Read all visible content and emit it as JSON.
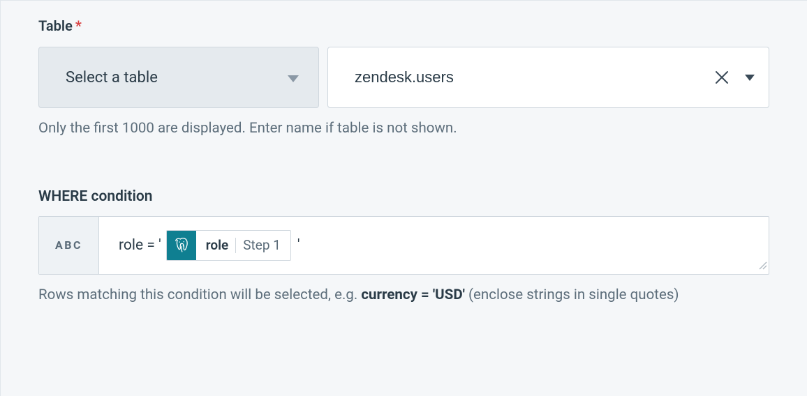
{
  "table": {
    "label": "Table",
    "required_mark": "*",
    "select_placeholder": "Select a table",
    "value": "zendesk.users",
    "helper": "Only the first 1000 are displayed. Enter name if table is not shown."
  },
  "where": {
    "label": "WHERE condition",
    "abc_label": "ABC",
    "expr_prefix": "role = '",
    "token_name": "role",
    "token_step": "Step 1",
    "expr_suffix": "'",
    "helper_before": "Rows matching this condition will be selected, e.g. ",
    "helper_strong": "currency = 'USD'",
    "helper_after": " (enclose strings in single quotes)"
  }
}
